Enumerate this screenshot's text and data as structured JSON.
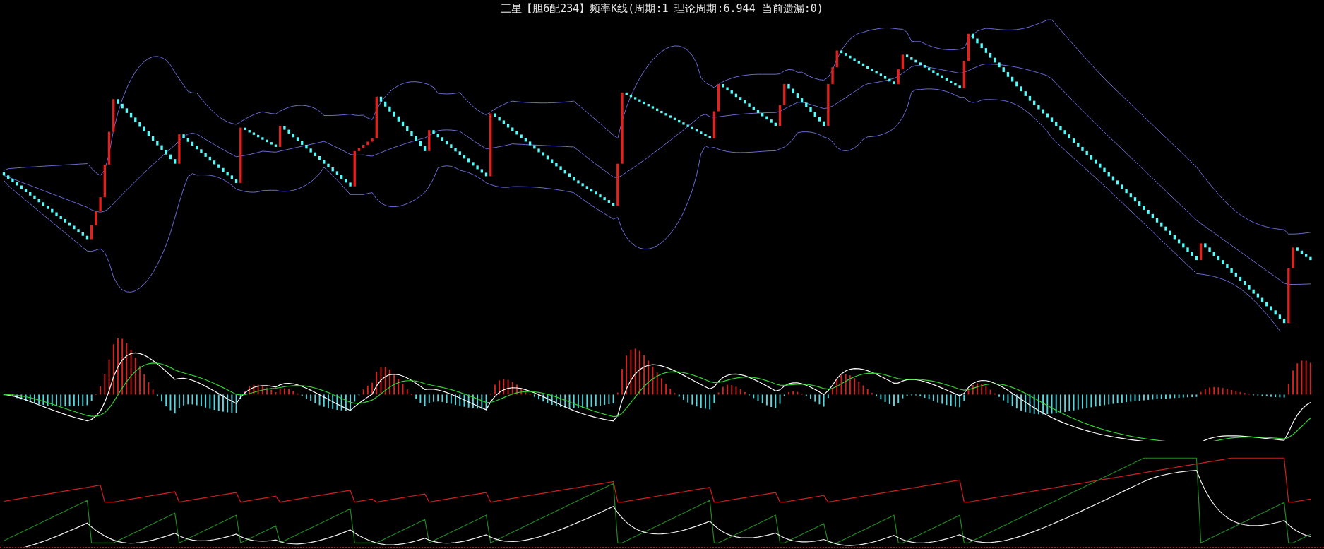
{
  "title": "三星【胆6配234】频率K线(周期:1 理论周期:6.944 当前遗漏:0)"
}
